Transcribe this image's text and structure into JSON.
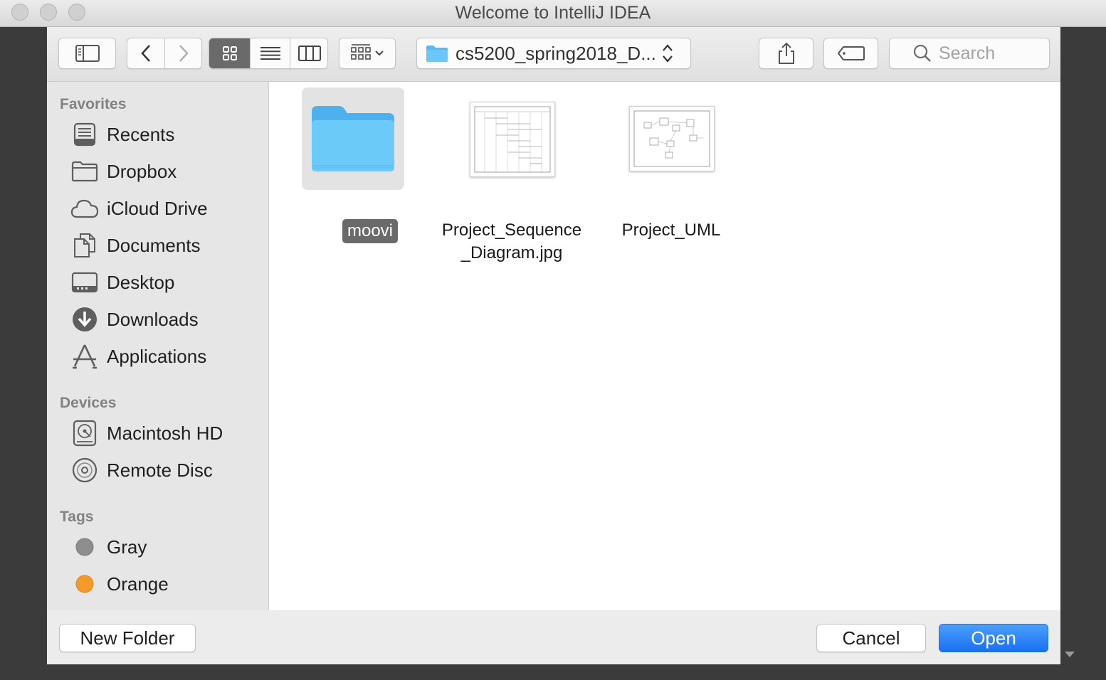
{
  "window": {
    "title": "Welcome to IntelliJ IDEA"
  },
  "toolbar": {
    "path_label": "cs5200_spring2018_D...",
    "search_placeholder": "Search"
  },
  "sidebar": {
    "sections": [
      {
        "title": "Favorites",
        "items": [
          {
            "label": "Recents",
            "icon": "recents-icon"
          },
          {
            "label": "Dropbox",
            "icon": "folder-icon"
          },
          {
            "label": "iCloud Drive",
            "icon": "cloud-icon"
          },
          {
            "label": "Documents",
            "icon": "documents-icon"
          },
          {
            "label": "Desktop",
            "icon": "desktop-icon"
          },
          {
            "label": "Downloads",
            "icon": "downloads-icon"
          },
          {
            "label": "Applications",
            "icon": "applications-icon"
          }
        ]
      },
      {
        "title": "Devices",
        "items": [
          {
            "label": "Macintosh HD",
            "icon": "hard-drive-icon"
          },
          {
            "label": "Remote Disc",
            "icon": "disc-icon"
          }
        ]
      },
      {
        "title": "Tags",
        "items": [
          {
            "label": "Gray",
            "icon": "tag-dot-icon",
            "color": "#8e8e8e"
          },
          {
            "label": "Orange",
            "icon": "tag-dot-icon",
            "color": "#f39a2b"
          }
        ]
      }
    ]
  },
  "files": [
    {
      "name": "moovi",
      "kind": "folder",
      "selected": true
    },
    {
      "name_line1": "Project_Sequence",
      "name_line2": "_Diagram.jpg",
      "kind": "image"
    },
    {
      "name": "Project_UML",
      "kind": "image"
    }
  ],
  "buttons": {
    "new_folder": "New Folder",
    "cancel": "Cancel",
    "open": "Open"
  },
  "colors": {
    "accent": "#1a6ff2",
    "folder": "#5ab8f5",
    "selection": "#6a6a6a"
  }
}
